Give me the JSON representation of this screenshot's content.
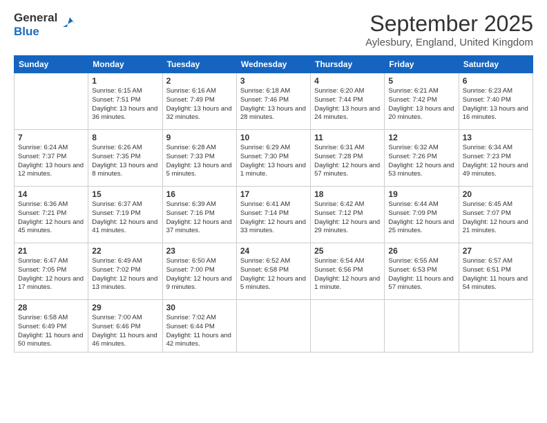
{
  "header": {
    "logo_general": "General",
    "logo_blue": "Blue",
    "month": "September 2025",
    "location": "Aylesbury, England, United Kingdom"
  },
  "days_of_week": [
    "Sunday",
    "Monday",
    "Tuesday",
    "Wednesday",
    "Thursday",
    "Friday",
    "Saturday"
  ],
  "weeks": [
    [
      {
        "day": "",
        "empty": true
      },
      {
        "day": "1",
        "sunrise": "Sunrise: 6:15 AM",
        "sunset": "Sunset: 7:51 PM",
        "daylight": "Daylight: 13 hours and 36 minutes."
      },
      {
        "day": "2",
        "sunrise": "Sunrise: 6:16 AM",
        "sunset": "Sunset: 7:49 PM",
        "daylight": "Daylight: 13 hours and 32 minutes."
      },
      {
        "day": "3",
        "sunrise": "Sunrise: 6:18 AM",
        "sunset": "Sunset: 7:46 PM",
        "daylight": "Daylight: 13 hours and 28 minutes."
      },
      {
        "day": "4",
        "sunrise": "Sunrise: 6:20 AM",
        "sunset": "Sunset: 7:44 PM",
        "daylight": "Daylight: 13 hours and 24 minutes."
      },
      {
        "day": "5",
        "sunrise": "Sunrise: 6:21 AM",
        "sunset": "Sunset: 7:42 PM",
        "daylight": "Daylight: 13 hours and 20 minutes."
      },
      {
        "day": "6",
        "sunrise": "Sunrise: 6:23 AM",
        "sunset": "Sunset: 7:40 PM",
        "daylight": "Daylight: 13 hours and 16 minutes."
      }
    ],
    [
      {
        "day": "7",
        "sunrise": "Sunrise: 6:24 AM",
        "sunset": "Sunset: 7:37 PM",
        "daylight": "Daylight: 13 hours and 12 minutes."
      },
      {
        "day": "8",
        "sunrise": "Sunrise: 6:26 AM",
        "sunset": "Sunset: 7:35 PM",
        "daylight": "Daylight: 13 hours and 8 minutes."
      },
      {
        "day": "9",
        "sunrise": "Sunrise: 6:28 AM",
        "sunset": "Sunset: 7:33 PM",
        "daylight": "Daylight: 13 hours and 5 minutes."
      },
      {
        "day": "10",
        "sunrise": "Sunrise: 6:29 AM",
        "sunset": "Sunset: 7:30 PM",
        "daylight": "Daylight: 13 hours and 1 minute."
      },
      {
        "day": "11",
        "sunrise": "Sunrise: 6:31 AM",
        "sunset": "Sunset: 7:28 PM",
        "daylight": "Daylight: 12 hours and 57 minutes."
      },
      {
        "day": "12",
        "sunrise": "Sunrise: 6:32 AM",
        "sunset": "Sunset: 7:26 PM",
        "daylight": "Daylight: 12 hours and 53 minutes."
      },
      {
        "day": "13",
        "sunrise": "Sunrise: 6:34 AM",
        "sunset": "Sunset: 7:23 PM",
        "daylight": "Daylight: 12 hours and 49 minutes."
      }
    ],
    [
      {
        "day": "14",
        "sunrise": "Sunrise: 6:36 AM",
        "sunset": "Sunset: 7:21 PM",
        "daylight": "Daylight: 12 hours and 45 minutes."
      },
      {
        "day": "15",
        "sunrise": "Sunrise: 6:37 AM",
        "sunset": "Sunset: 7:19 PM",
        "daylight": "Daylight: 12 hours and 41 minutes."
      },
      {
        "day": "16",
        "sunrise": "Sunrise: 6:39 AM",
        "sunset": "Sunset: 7:16 PM",
        "daylight": "Daylight: 12 hours and 37 minutes."
      },
      {
        "day": "17",
        "sunrise": "Sunrise: 6:41 AM",
        "sunset": "Sunset: 7:14 PM",
        "daylight": "Daylight: 12 hours and 33 minutes."
      },
      {
        "day": "18",
        "sunrise": "Sunrise: 6:42 AM",
        "sunset": "Sunset: 7:12 PM",
        "daylight": "Daylight: 12 hours and 29 minutes."
      },
      {
        "day": "19",
        "sunrise": "Sunrise: 6:44 AM",
        "sunset": "Sunset: 7:09 PM",
        "daylight": "Daylight: 12 hours and 25 minutes."
      },
      {
        "day": "20",
        "sunrise": "Sunrise: 6:45 AM",
        "sunset": "Sunset: 7:07 PM",
        "daylight": "Daylight: 12 hours and 21 minutes."
      }
    ],
    [
      {
        "day": "21",
        "sunrise": "Sunrise: 6:47 AM",
        "sunset": "Sunset: 7:05 PM",
        "daylight": "Daylight: 12 hours and 17 minutes."
      },
      {
        "day": "22",
        "sunrise": "Sunrise: 6:49 AM",
        "sunset": "Sunset: 7:02 PM",
        "daylight": "Daylight: 12 hours and 13 minutes."
      },
      {
        "day": "23",
        "sunrise": "Sunrise: 6:50 AM",
        "sunset": "Sunset: 7:00 PM",
        "daylight": "Daylight: 12 hours and 9 minutes."
      },
      {
        "day": "24",
        "sunrise": "Sunrise: 6:52 AM",
        "sunset": "Sunset: 6:58 PM",
        "daylight": "Daylight: 12 hours and 5 minutes."
      },
      {
        "day": "25",
        "sunrise": "Sunrise: 6:54 AM",
        "sunset": "Sunset: 6:56 PM",
        "daylight": "Daylight: 12 hours and 1 minute."
      },
      {
        "day": "26",
        "sunrise": "Sunrise: 6:55 AM",
        "sunset": "Sunset: 6:53 PM",
        "daylight": "Daylight: 11 hours and 57 minutes."
      },
      {
        "day": "27",
        "sunrise": "Sunrise: 6:57 AM",
        "sunset": "Sunset: 6:51 PM",
        "daylight": "Daylight: 11 hours and 54 minutes."
      }
    ],
    [
      {
        "day": "28",
        "sunrise": "Sunrise: 6:58 AM",
        "sunset": "Sunset: 6:49 PM",
        "daylight": "Daylight: 11 hours and 50 minutes."
      },
      {
        "day": "29",
        "sunrise": "Sunrise: 7:00 AM",
        "sunset": "Sunset: 6:46 PM",
        "daylight": "Daylight: 11 hours and 46 minutes."
      },
      {
        "day": "30",
        "sunrise": "Sunrise: 7:02 AM",
        "sunset": "Sunset: 6:44 PM",
        "daylight": "Daylight: 11 hours and 42 minutes."
      },
      {
        "day": "",
        "empty": true
      },
      {
        "day": "",
        "empty": true
      },
      {
        "day": "",
        "empty": true
      },
      {
        "day": "",
        "empty": true
      }
    ]
  ]
}
